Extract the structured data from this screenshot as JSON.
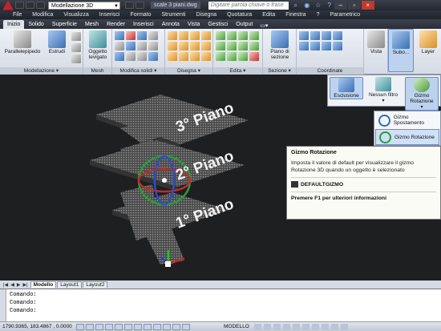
{
  "titlebar": {
    "workspace": "Modellazione 3D",
    "file": "scale 3 piani.dwg",
    "search_placeholder": "Digitare parola chiave o frase"
  },
  "menu": [
    "File",
    "Modifica",
    "Visualizza",
    "Inserisci",
    "Formato",
    "Strumenti",
    "Disegna",
    "Quotatura",
    "Edita",
    "Finestra",
    "?",
    "Parametrico"
  ],
  "ribbon_tabs": [
    "Inizio",
    "Solido",
    "Superficie",
    "Mesh",
    "Render",
    "Inserisci",
    "Annota",
    "Vista",
    "Gestisci",
    "Output"
  ],
  "ribbon": {
    "parallelepipedo": "Parallelepipedo",
    "estrudi": "Estrudi",
    "oggetto_levigato": "Oggetto levigato",
    "piano_sezione": "Piano di sezione",
    "vista": "Vista",
    "subo": "Subo...",
    "layer": "Layer",
    "panels": {
      "modellazione": "Modellazione",
      "mesh": "Mesh",
      "modifica_solidi": "Modifica solidi",
      "disegna": "Disegna",
      "edita": "Edita",
      "sezione": "Sezione",
      "coordinate": "Coordinate"
    }
  },
  "subpanel": {
    "esclusione": "Esclusione",
    "nessun_filtro": "Nessun filtro",
    "gizmo_rotazione": "Gizmo Rotazione"
  },
  "gizmo_menu": {
    "spostamento": "Gizmo Spostamento",
    "rotazione": "Gizmo Rotazione"
  },
  "tooltip": {
    "title": "Gizmo Rotazione",
    "description": "Imposta il valore di default per visualizzare il gizmo Rotazione 3D quando un oggetto è selezionato",
    "command": "DEFAULTGIZMO",
    "help": "Premere F1 per ulteriori informazioni"
  },
  "viewport": {
    "labels": [
      "3° Piano",
      "2° Piano",
      "1° Piano"
    ]
  },
  "tabs": [
    "Modello",
    "Layout1",
    "Layout2"
  ],
  "command_lines": [
    "Comando:",
    "Comando:",
    "Comando:"
  ],
  "status": {
    "coords": "1790.9365, 183.4867 , 0.0000",
    "space": "MODELLO"
  }
}
